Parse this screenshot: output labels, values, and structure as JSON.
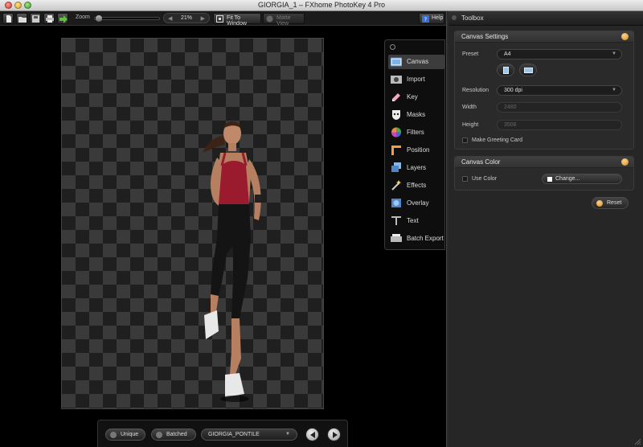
{
  "window": {
    "title": "GIORGIA_1 – FXhome PhotoKey 4 Pro"
  },
  "toolbar": {
    "zoom_label": "Zoom",
    "zoom_value": "21%",
    "fit_to_window": "Fit To Window",
    "matte_view": "Matte View",
    "help": "Help"
  },
  "tool_menu": {
    "items": [
      {
        "label": "Canvas",
        "icon": "canvas-icon",
        "active": true
      },
      {
        "label": "Import",
        "icon": "import-icon"
      },
      {
        "label": "Key",
        "icon": "key-icon"
      },
      {
        "label": "Masks",
        "icon": "masks-icon"
      },
      {
        "label": "Filters",
        "icon": "filters-icon"
      },
      {
        "label": "Position",
        "icon": "position-icon"
      },
      {
        "label": "Layers",
        "icon": "layers-icon"
      },
      {
        "label": "Effects",
        "icon": "effects-icon"
      },
      {
        "label": "Overlay",
        "icon": "overlay-icon"
      },
      {
        "label": "Text",
        "icon": "text-icon"
      },
      {
        "label": "Batch Export",
        "icon": "batch-export-icon"
      }
    ]
  },
  "toolbox": {
    "title": "Toolbox",
    "canvas_settings": {
      "title": "Canvas Settings",
      "preset_label": "Preset",
      "preset_value": "A4",
      "resolution_label": "Resolution",
      "resolution_value": "300 dpi",
      "width_label": "Width",
      "width_value": "2480",
      "height_label": "Height",
      "height_value": "3508",
      "greeting_card_label": "Make Greeting Card"
    },
    "canvas_color": {
      "title": "Canvas Color",
      "use_color_label": "Use Color",
      "change_button": "Change..."
    },
    "reset_button": "Reset"
  },
  "bottom_bar": {
    "unique": "Unique",
    "batched": "Batched",
    "selected_image": "GIORGIA_PONTILE"
  },
  "colors": {
    "checker_light": "#3a3a3a",
    "checker_dark": "#1f1f1f",
    "accent_orange": "#d18a1f"
  }
}
